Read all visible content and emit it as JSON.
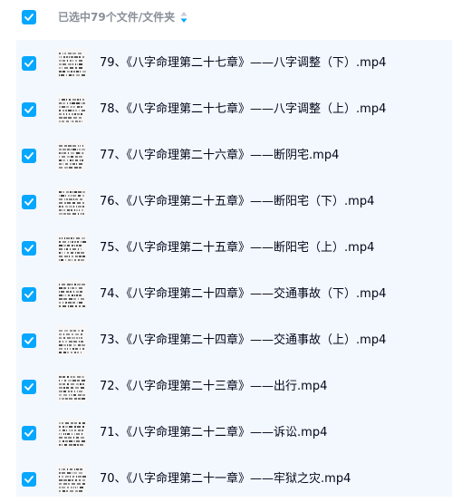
{
  "header": {
    "selection_text": "已选中79个文件/文件夹",
    "checked": true
  },
  "colors": {
    "accent": "#06a7ff",
    "list_bg": "#f3f7fe",
    "header_text": "#8a8f99",
    "file_text": "#03081a"
  },
  "files": [
    {
      "name": "79、《八字命理第二十七章》——八字调整（下）.mp4",
      "checked": true
    },
    {
      "name": "78、《八字命理第二十七章》——八字调整（上）.mp4",
      "checked": true
    },
    {
      "name": "77、《八字命理第二十六章》——断阴宅.mp4",
      "checked": true
    },
    {
      "name": "76、《八字命理第二十五章》——断阳宅（下）.mp4",
      "checked": true
    },
    {
      "name": "75、《八字命理第二十五章》——断阳宅（上）.mp4",
      "checked": true
    },
    {
      "name": "74、《八字命理第二十四章》——交通事故（下）.mp4",
      "checked": true
    },
    {
      "name": "73、《八字命理第二十四章》——交通事故（上）.mp4",
      "checked": true
    },
    {
      "name": "72、《八字命理第二十三章》——出行.mp4",
      "checked": true
    },
    {
      "name": "71、《八字命理第二十二章》——诉讼.mp4",
      "checked": true
    },
    {
      "name": "70、《八字命理第二十一章》——牢狱之灾.mp4",
      "checked": true
    }
  ]
}
